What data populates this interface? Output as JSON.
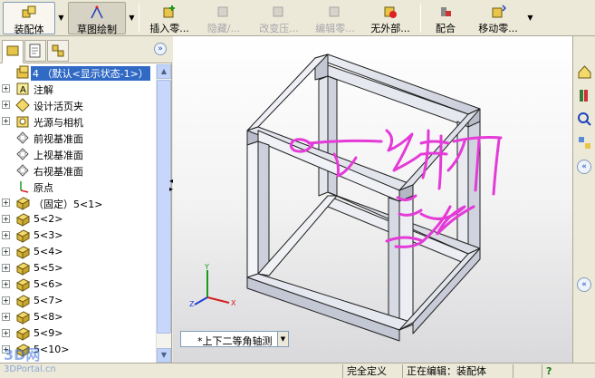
{
  "toolbar": {
    "buttons": [
      {
        "label": "装配体",
        "icon": "assembly-icon",
        "state": "pressed"
      },
      {
        "label": "草图绘制",
        "icon": "sketch-icon",
        "state": "pressed2"
      },
      {
        "label": "插入零...",
        "icon": "insert-components-icon",
        "state": "normal"
      },
      {
        "label": "隐藏/...",
        "icon": "hide-show-icon",
        "state": "disabled"
      },
      {
        "label": "改变压...",
        "icon": "change-suppression-icon",
        "state": "disabled"
      },
      {
        "label": "编辑零...",
        "icon": "edit-component-icon",
        "state": "disabled"
      },
      {
        "label": "无外部...",
        "icon": "no-external-refs-icon",
        "state": "normal"
      },
      {
        "label": "配合",
        "icon": "mate-icon",
        "state": "normal"
      },
      {
        "label": "移动零...",
        "icon": "move-component-icon",
        "state": "normal"
      }
    ]
  },
  "tree": {
    "items": [
      {
        "label": "4 （默认<显示状态-1>）",
        "icon": "assembly-root-icon",
        "expander": "",
        "selected": true
      },
      {
        "label": "注解",
        "icon": "annotations-icon",
        "expander": "+"
      },
      {
        "label": "设计活页夹",
        "icon": "design-binder-icon",
        "expander": "+"
      },
      {
        "label": "光源与相机",
        "icon": "lights-cameras-icon",
        "expander": "+"
      },
      {
        "label": "前视基准面",
        "icon": "plane-icon",
        "expander": ""
      },
      {
        "label": "上视基准面",
        "icon": "plane-icon",
        "expander": ""
      },
      {
        "label": "右视基准面",
        "icon": "plane-icon",
        "expander": ""
      },
      {
        "label": "原点",
        "icon": "origin-icon",
        "expander": ""
      },
      {
        "label": "（固定）5<1>",
        "icon": "part-icon",
        "expander": "+"
      },
      {
        "label": "5<2>",
        "icon": "part-icon",
        "expander": "+"
      },
      {
        "label": "5<3>",
        "icon": "part-icon",
        "expander": "+"
      },
      {
        "label": "5<4>",
        "icon": "part-icon",
        "expander": "+"
      },
      {
        "label": "5<5>",
        "icon": "part-icon",
        "expander": "+"
      },
      {
        "label": "5<6>",
        "icon": "part-icon",
        "expander": "+"
      },
      {
        "label": "5<7>",
        "icon": "part-icon",
        "expander": "+"
      },
      {
        "label": "5<8>",
        "icon": "part-icon",
        "expander": "+"
      },
      {
        "label": "5<9>",
        "icon": "part-icon",
        "expander": "+"
      },
      {
        "label": "5<10>",
        "icon": "part-icon",
        "expander": "+"
      }
    ]
  },
  "viewport": {
    "annotation_text": "这里断开",
    "view_orientation": "*上下二等角轴测",
    "triad": {
      "x": "X",
      "y": "Y",
      "z": "Z"
    }
  },
  "statusbar": {
    "definition": "完全定义",
    "editing": "正在编辑：装配体",
    "help": "?"
  },
  "watermark": {
    "line1": "3D网",
    "line2": "3DPortal.cn"
  },
  "colors": {
    "selection": "#316ac5",
    "annotation": "#e43ad8",
    "frame": "#d6d8e3",
    "triad_x": "#d42020",
    "triad_y": "#1a9a1a",
    "triad_z": "#2040d0"
  }
}
